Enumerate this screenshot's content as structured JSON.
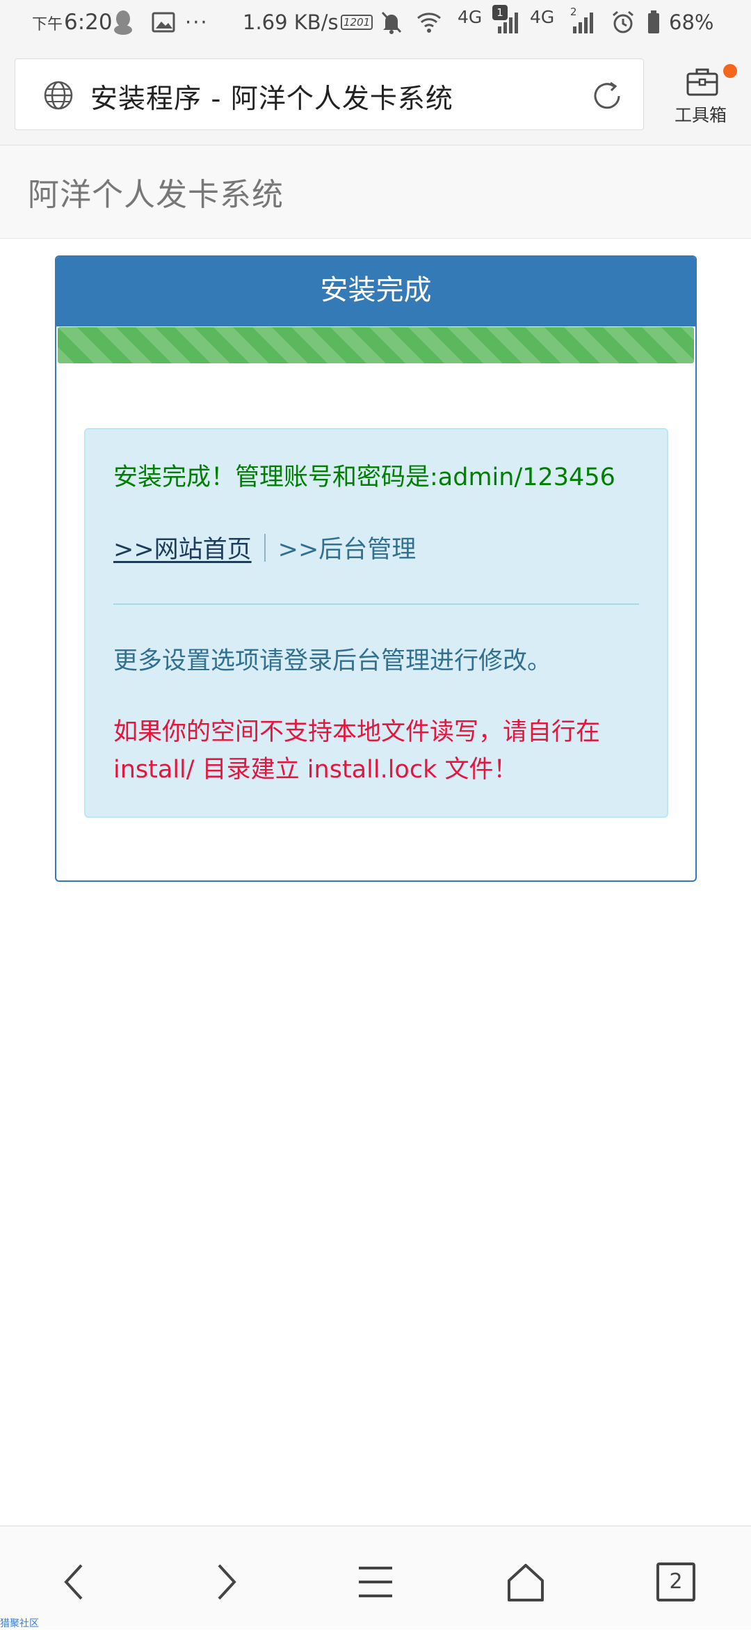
{
  "status_bar": {
    "ampm": "下午",
    "time": "6:20",
    "speed": "1.69 KB/s",
    "hd_badge": "1201",
    "net1": "4G",
    "sim1": "1",
    "net2": "4G",
    "sim2": "2",
    "battery": "68%"
  },
  "browser": {
    "tab_title": "安装程序 - 阿洋个人发卡系统",
    "toolbox_label": "工具箱",
    "tabs_count": "2"
  },
  "page": {
    "brand": "阿洋个人发卡系统",
    "panel_title": "安装完成",
    "progress_percent": 100,
    "success_message": "安装完成！管理账号和密码是:admin/123456",
    "link_home": ">>网站首页",
    "link_admin": ">>后台管理",
    "info_message": "更多设置选项请登录后台管理进行修改。",
    "warning_message": "如果你的空间不支持本地文件读写，请自行在install/ 目录建立 install.lock 文件！"
  },
  "watermark": "猎聚社区",
  "colors": {
    "primary": "#337ab7",
    "success": "#5cb85c",
    "info_bg": "#d9edf7",
    "success_text": "#008000",
    "warning_text": "#e5153d"
  }
}
